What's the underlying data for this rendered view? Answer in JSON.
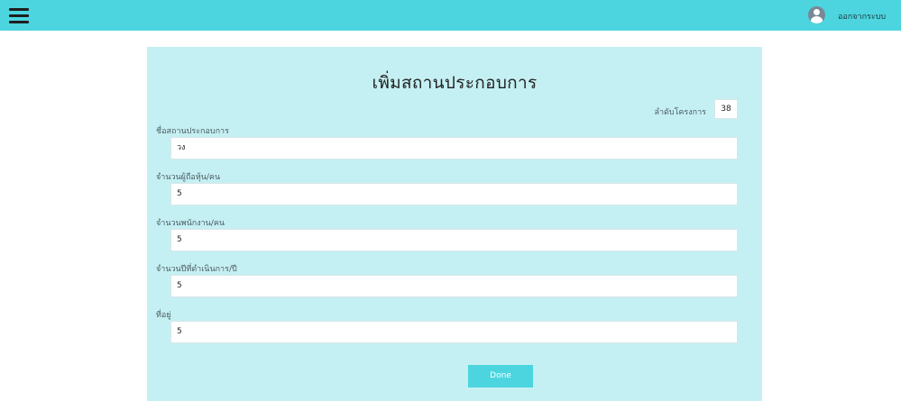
{
  "header": {
    "menu_icon": "hamburger-menu-icon",
    "avatar_icon": "user-avatar-icon",
    "logout_label": "ออกจากระบบ",
    "bar_color": "#4cd5df"
  },
  "form": {
    "title": "เพิ่มสถานประกอบการ",
    "project_number_label": "ลำดับโครงการ",
    "project_number_value": "38",
    "fields": [
      {
        "label": "ชื่อสถานประกอบการ",
        "value": "วง"
      },
      {
        "label": "จำนวนผู้ถือหุ้น/คน",
        "value": "5"
      },
      {
        "label": "จำนวนพนักงาน/คน",
        "value": "5"
      },
      {
        "label": "จำนวนปีที่ดำเนินการ/ปี",
        "value": "5"
      },
      {
        "label": "ที่อยู่",
        "value": "5"
      }
    ],
    "done_label": "Done",
    "panel_color": "#c5f0f3"
  }
}
